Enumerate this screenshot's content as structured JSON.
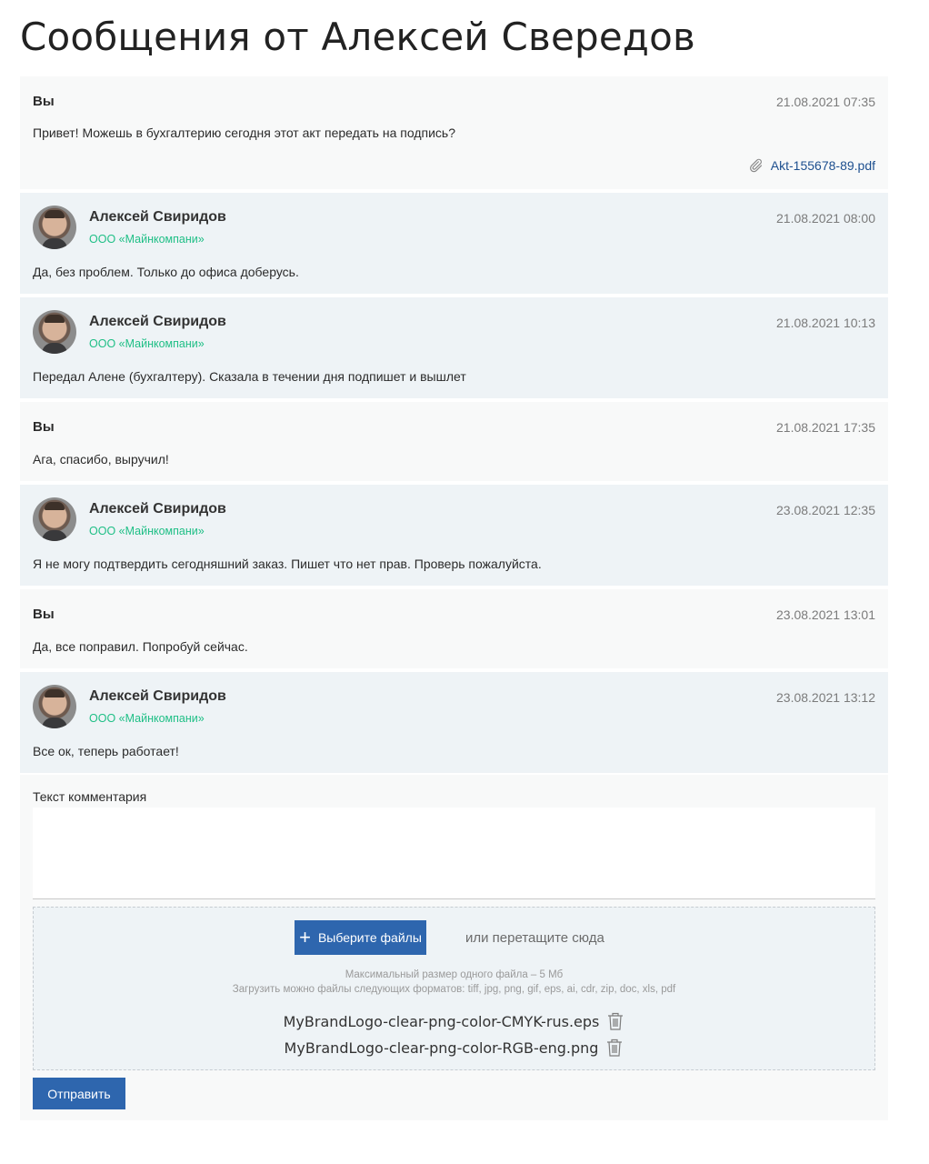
{
  "page": {
    "title": "Сообщения от Алексей Свередов"
  },
  "messages": [
    {
      "type": "you",
      "author": "Вы",
      "date": "21.08.2021 07:35",
      "text": "Привет! Можешь в бухгалтерию сегодня этот акт передать на подпись?",
      "attachment": "Akt-155678-89.pdf"
    },
    {
      "type": "other",
      "author": "Алексей Свиридов",
      "company": "ООО «Майнкомпани»",
      "date": "21.08.2021 08:00",
      "text": "Да, без проблем. Только до офиса доберусь."
    },
    {
      "type": "other",
      "author": "Алексей Свиридов",
      "company": "ООО «Майнкомпани»",
      "date": "21.08.2021 10:13",
      "text": "Передал Алене (бухгалтеру). Сказала в течении дня подпишет и вышлет"
    },
    {
      "type": "you",
      "author": "Вы",
      "date": "21.08.2021 17:35",
      "text": "Ага, спасибо, выручил!"
    },
    {
      "type": "other",
      "author": "Алексей Свиридов",
      "company": "ООО «Майнкомпани»",
      "date": "23.08.2021 12:35",
      "text": "Я не могу подтвердить сегодняшний заказ. Пишет что нет прав. Проверь пожалуйста."
    },
    {
      "type": "you",
      "author": "Вы",
      "date": "23.08.2021 13:01",
      "text": "Да, все поправил. Попробуй сейчас."
    },
    {
      "type": "other",
      "author": "Алексей Свиридов",
      "company": "ООО «Майнкомпани»",
      "date": "23.08.2021 13:12",
      "text": "Все ок, теперь работает!"
    }
  ],
  "composer": {
    "label": "Текст комментария",
    "comment_value": "",
    "choose_files_label": "Выберите файлы",
    "or_drag_label": "или перетащите сюда",
    "max_size_hint": "Максимальный размер одного файла – 5 Мб",
    "formats_hint": "Загрузить можно файлы следующих форматов: tiff, jpg, png, gif, eps, ai, cdr, zip, doc, xls, pdf",
    "files": [
      "MyBrandLogo-clear-png-color-CMYK-rus.eps",
      "MyBrandLogo-clear-png-color-RGB-eng.png"
    ],
    "send_label": "Отправить"
  },
  "icons": {
    "attachment": "paperclip-icon",
    "add": "plus-icon",
    "delete": "trash-icon",
    "avatar": "user-photo"
  },
  "colors": {
    "accent": "#2e66ae",
    "company": "#1fbf86",
    "link": "#1d4f8f",
    "bg_you": "#f8f9f9",
    "bg_other": "#eef3f6"
  }
}
